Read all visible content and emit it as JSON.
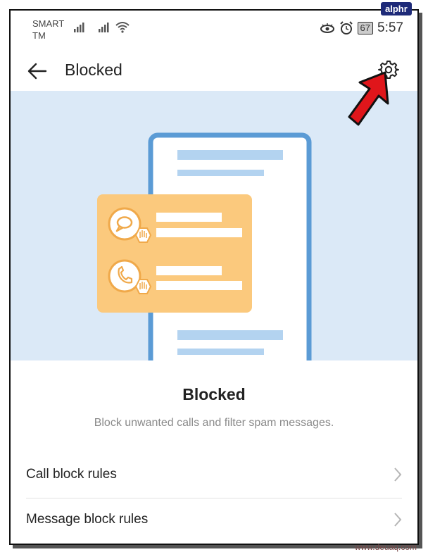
{
  "status_bar": {
    "carrier_line1": "SMART",
    "carrier_line2": "TM",
    "battery": "67",
    "time": "5:57"
  },
  "app_bar": {
    "title": "Blocked"
  },
  "hero": {
    "card_rows": [
      {
        "icon": "message-bubble-icon"
      },
      {
        "icon": "phone-icon"
      }
    ]
  },
  "content": {
    "heading": "Blocked",
    "description": "Block unwanted calls and filter spam messages."
  },
  "menu": [
    {
      "label": "Call block rules"
    },
    {
      "label": "Message block rules"
    }
  ],
  "overlay": {
    "badge": "alphr",
    "watermark": "www.deuaq.com"
  },
  "colors": {
    "hero_bg": "#dbe9f7",
    "phone_outline": "#5b9bd5",
    "card": "#fbc97d",
    "annotation_arrow": "#e0161b"
  }
}
